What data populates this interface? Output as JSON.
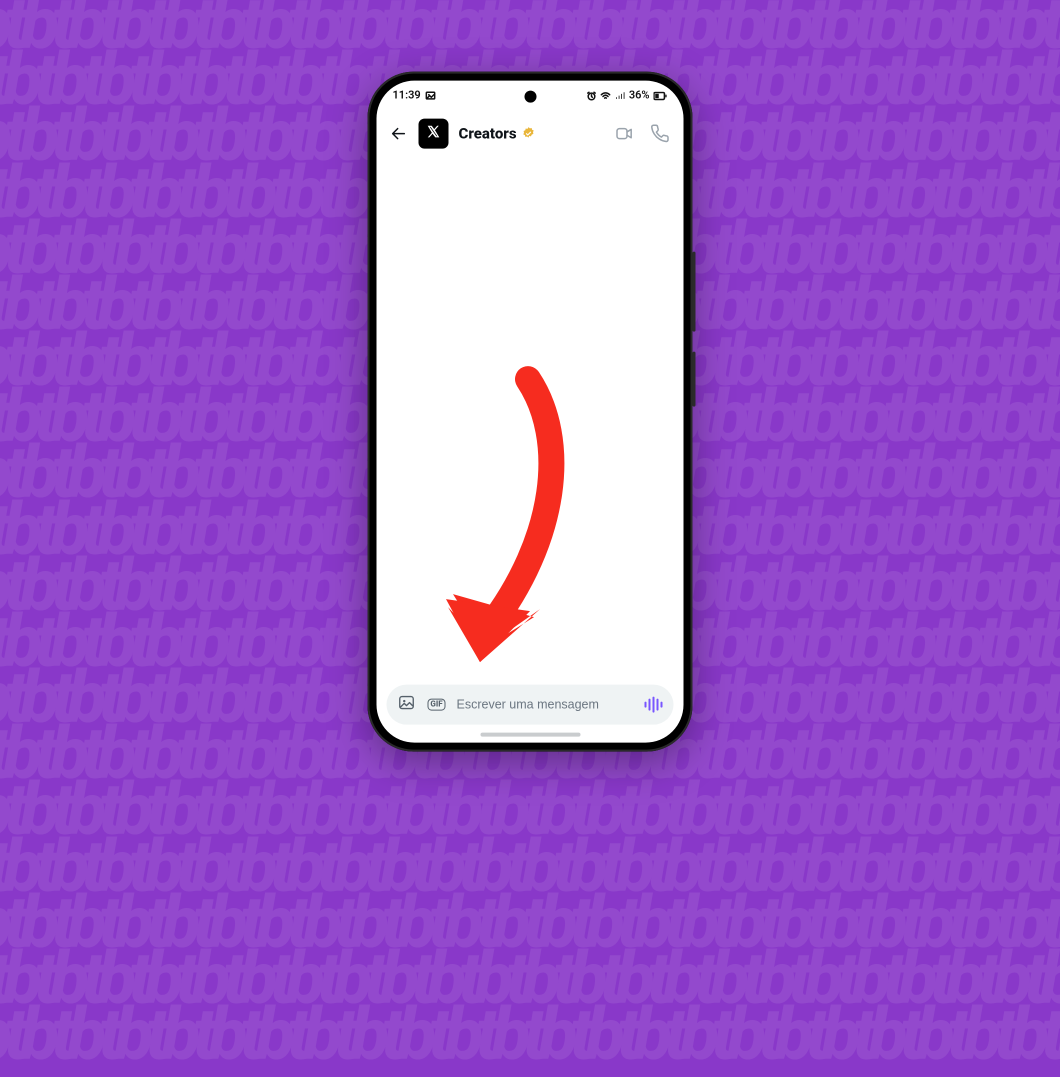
{
  "background": {
    "color": "#8938c9",
    "pattern_text": "tb"
  },
  "statusbar": {
    "time": "11:39",
    "left_icon": "image-indicator",
    "right_icons": [
      "alarm",
      "wifi",
      "signal"
    ],
    "battery_text": "36%",
    "battery_icon": "battery"
  },
  "header": {
    "back_icon": "arrow-left",
    "avatar_platform_icon": "x-logo",
    "title": "Creators",
    "verified_badge_icon": "verified-gold",
    "actions": {
      "video_icon": "video-camera",
      "call_icon": "phone-call"
    }
  },
  "composer": {
    "image_icon": "image",
    "gif_label": "GIF",
    "placeholder": "Escrever uma mensagem",
    "voice_icon": "voice-waveform",
    "voice_icon_color": "#7856ff"
  },
  "annotation": {
    "arrow_color": "#f62c1f",
    "arrow_target": "message-input"
  }
}
